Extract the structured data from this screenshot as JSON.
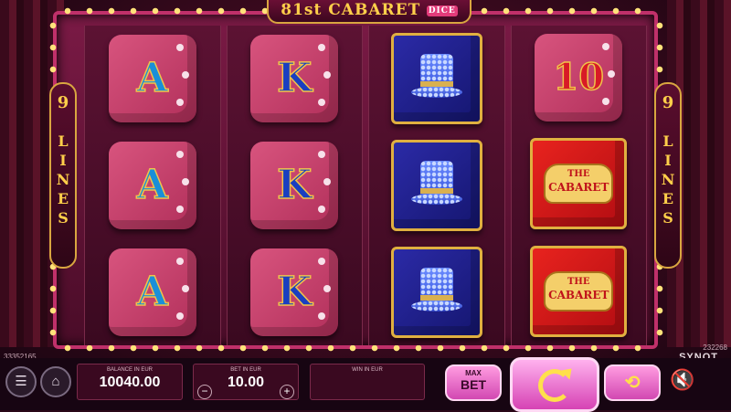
{
  "game": {
    "title": "81st CABARET",
    "title_badge": "DICE",
    "lines_number": "9",
    "lines_word": "LINES"
  },
  "reels": [
    [
      "A",
      "A",
      "A"
    ],
    [
      "K",
      "K",
      "K"
    ],
    [
      "top-hat",
      "top-hat",
      "top-hat"
    ],
    [
      "10",
      "the-cabaret",
      "the-cabaret"
    ]
  ],
  "symbol_text": {
    "A": "A",
    "K": "K",
    "10": "10",
    "cabaret_small": "THE",
    "cabaret_big": "CABARET"
  },
  "ids": {
    "left": "33352165",
    "right": "232268"
  },
  "brand": "SYNOT",
  "panel": {
    "balance_label": "BALANCE IN EUR",
    "balance_value": "10040.00",
    "bet_label": "BET IN EUR",
    "bet_value": "10.00",
    "win_label": "WIN IN EUR",
    "win_value": "",
    "max_bet_top": "MAX",
    "max_bet_bottom": "BET",
    "minus": "−",
    "plus": "+"
  },
  "icons": {
    "menu": "menu-icon",
    "home": "home-icon",
    "spin": "spin-icon",
    "autoplay": "autoplay-icon",
    "sound": "sound-icon"
  },
  "colors": {
    "frame": "#c0306a",
    "gold": "#ffcf4a",
    "spin": "#d643b4"
  }
}
